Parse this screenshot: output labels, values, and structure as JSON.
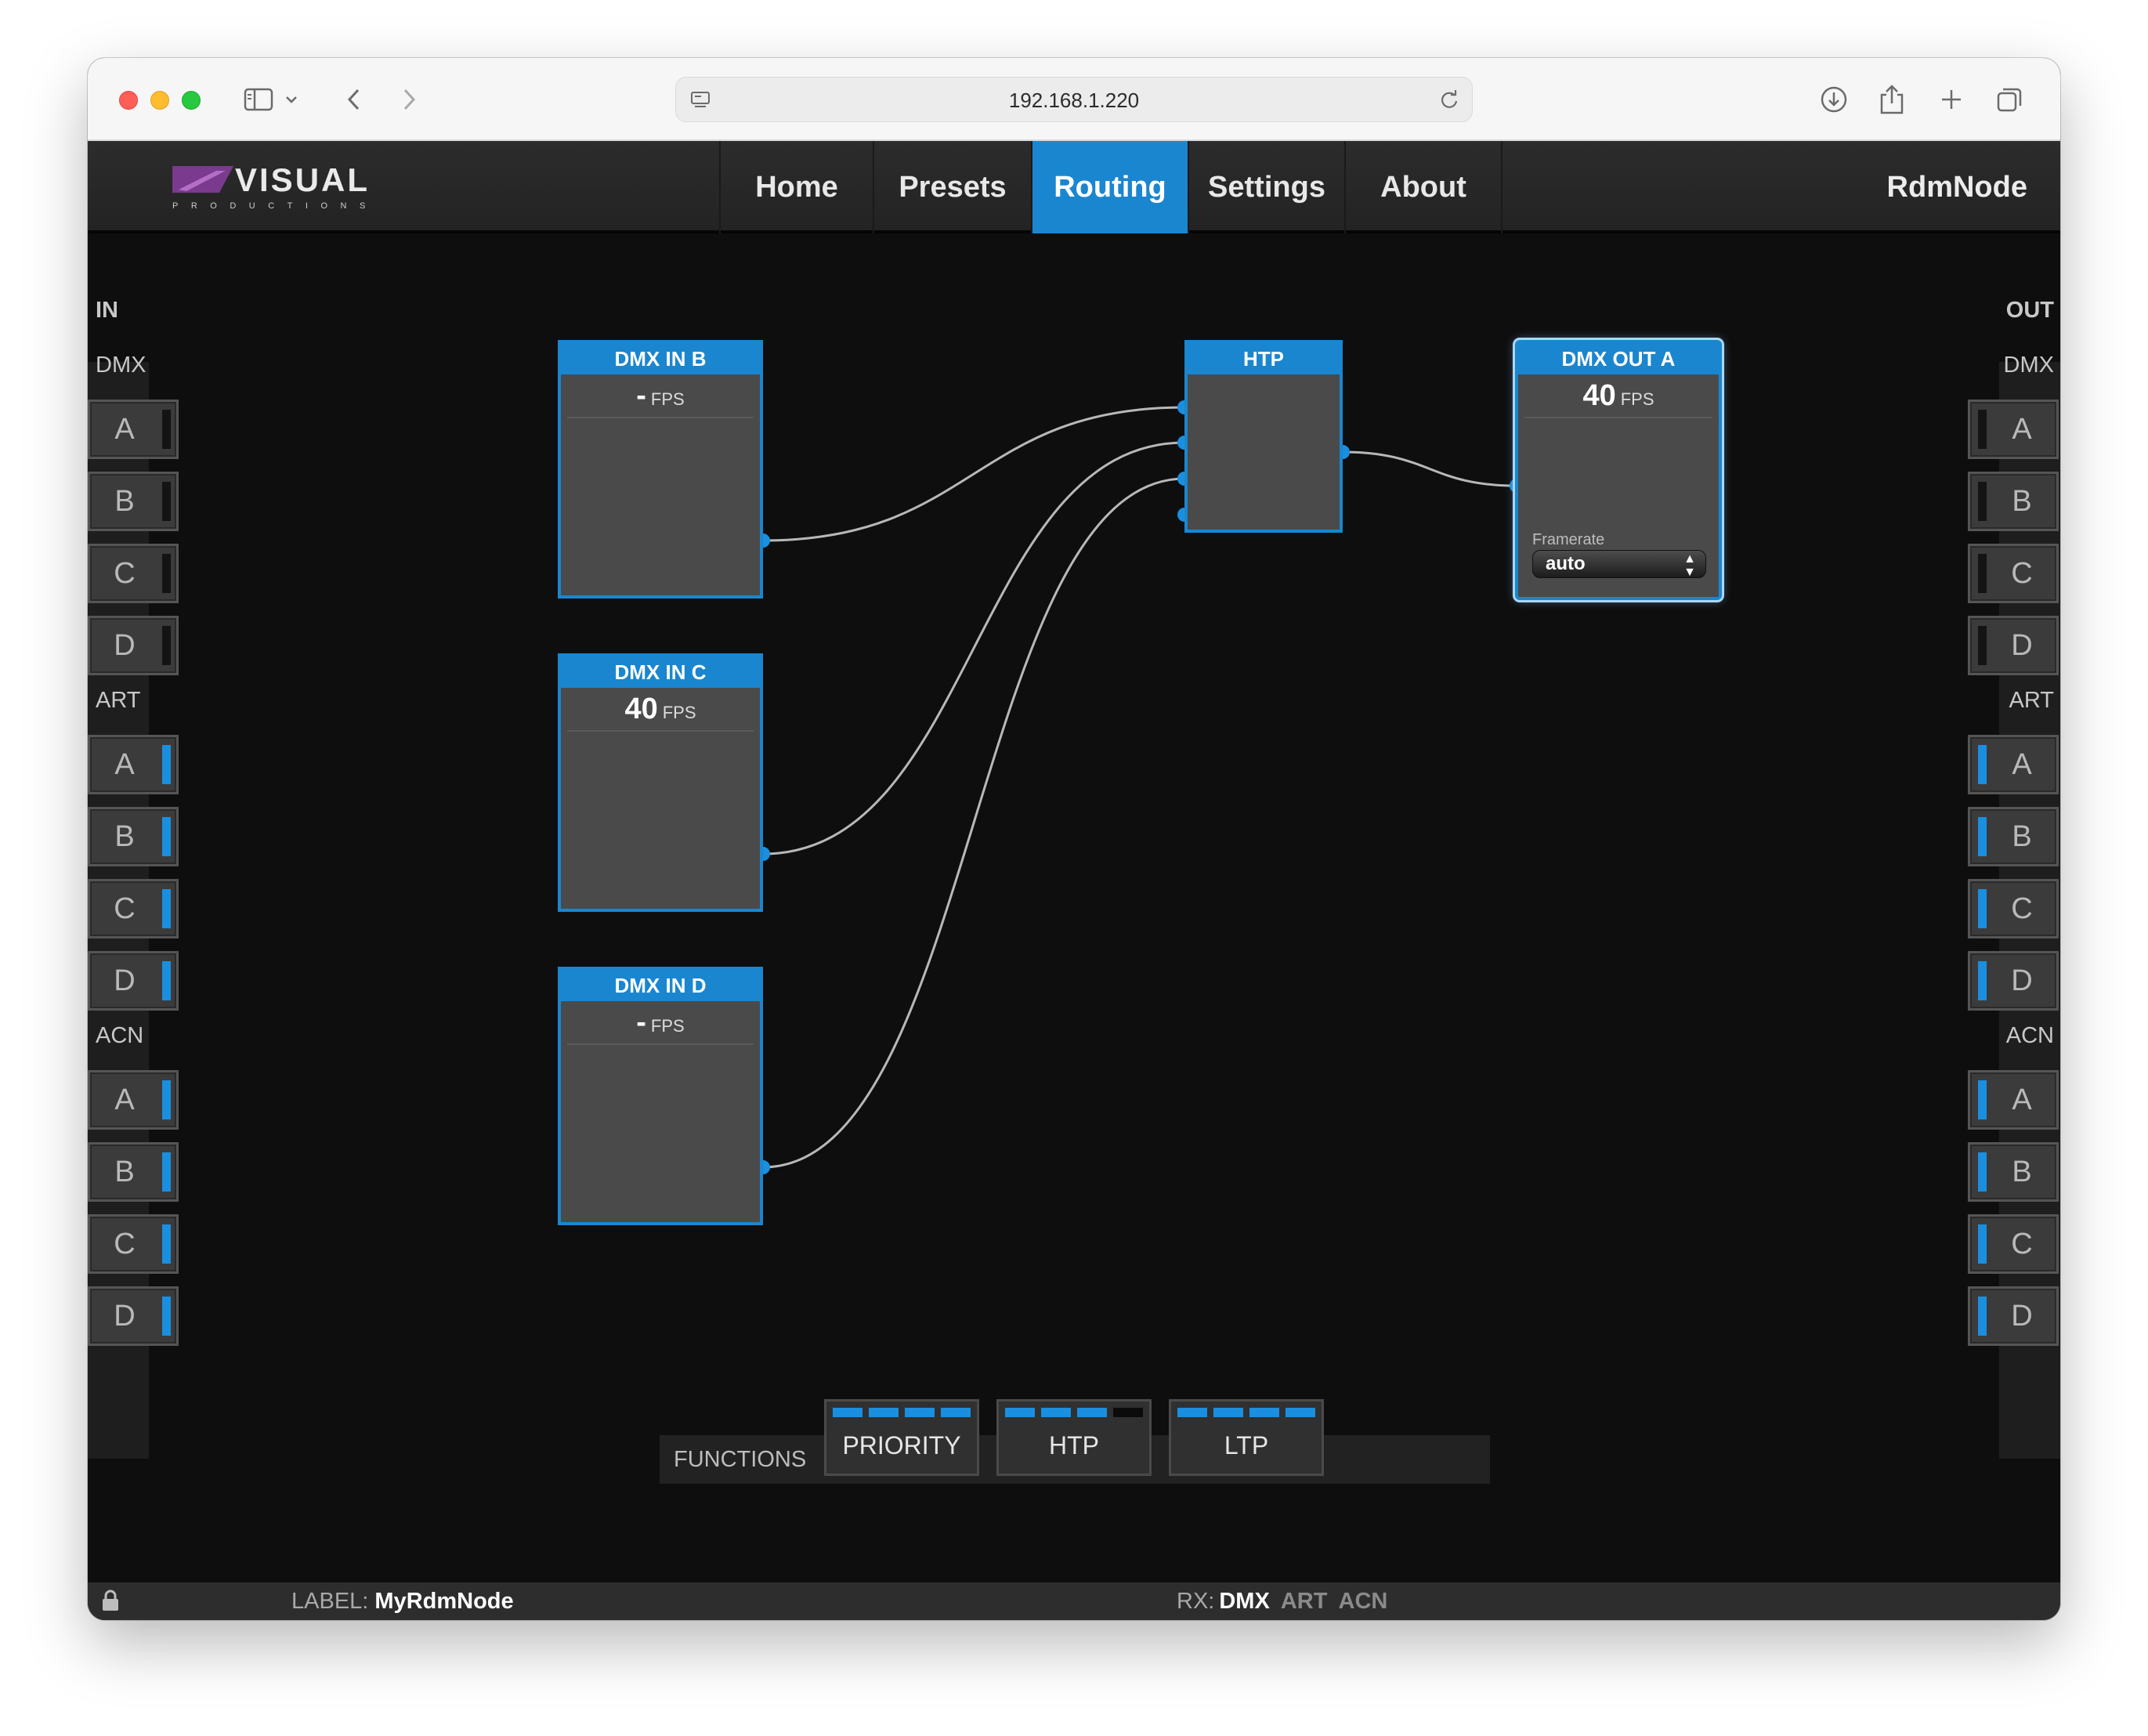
{
  "browser": {
    "url": "192.168.1.220"
  },
  "header": {
    "logo_text": "VISUAL",
    "logo_subtext": "PRODUCTIONS",
    "nav": [
      {
        "label": "Home",
        "active": false
      },
      {
        "label": "Presets",
        "active": false
      },
      {
        "label": "Routing",
        "active": true
      },
      {
        "label": "Settings",
        "active": false
      },
      {
        "label": "About",
        "active": false
      }
    ],
    "device_name": "RdmNode"
  },
  "inputs": {
    "title": "IN",
    "groups": [
      {
        "name": "DMX",
        "ports": [
          {
            "label": "A",
            "active": false
          },
          {
            "label": "B",
            "active": false
          },
          {
            "label": "C",
            "active": false
          },
          {
            "label": "D",
            "active": false
          }
        ]
      },
      {
        "name": "ART",
        "ports": [
          {
            "label": "A",
            "active": true
          },
          {
            "label": "B",
            "active": true
          },
          {
            "label": "C",
            "active": true
          },
          {
            "label": "D",
            "active": true
          }
        ]
      },
      {
        "name": "ACN",
        "ports": [
          {
            "label": "A",
            "active": true
          },
          {
            "label": "B",
            "active": true
          },
          {
            "label": "C",
            "active": true
          },
          {
            "label": "D",
            "active": true
          }
        ]
      }
    ]
  },
  "outputs": {
    "title": "OUT",
    "groups": [
      {
        "name": "DMX",
        "ports": [
          {
            "label": "A",
            "active": false
          },
          {
            "label": "B",
            "active": false
          },
          {
            "label": "C",
            "active": false
          },
          {
            "label": "D",
            "active": false
          }
        ]
      },
      {
        "name": "ART",
        "ports": [
          {
            "label": "A",
            "active": true
          },
          {
            "label": "B",
            "active": true
          },
          {
            "label": "C",
            "active": true
          },
          {
            "label": "D",
            "active": true
          }
        ]
      },
      {
        "name": "ACN",
        "ports": [
          {
            "label": "A",
            "active": true
          },
          {
            "label": "B",
            "active": true
          },
          {
            "label": "C",
            "active": true
          },
          {
            "label": "D",
            "active": true
          }
        ]
      }
    ]
  },
  "nodes": {
    "dmx_in_b": {
      "title": "DMX IN B",
      "fps": "-",
      "fps_unit": "FPS"
    },
    "dmx_in_c": {
      "title": "DMX IN C",
      "fps": "40",
      "fps_unit": "FPS"
    },
    "dmx_in_d": {
      "title": "DMX IN D",
      "fps": "-",
      "fps_unit": "FPS"
    },
    "htp": {
      "title": "HTP"
    },
    "dmx_out_a": {
      "title": "DMX OUT A",
      "fps": "40",
      "fps_unit": "FPS",
      "framerate_label": "Framerate",
      "framerate_value": "auto"
    }
  },
  "functions": {
    "label": "FUNCTIONS",
    "buttons": [
      {
        "label": "PRIORITY",
        "meter": [
          true,
          true,
          true,
          true
        ]
      },
      {
        "label": "HTP",
        "meter": [
          true,
          true,
          true,
          false
        ]
      },
      {
        "label": "LTP",
        "meter": [
          true,
          true,
          true,
          true
        ]
      }
    ]
  },
  "status": {
    "label_prefix": "LABEL:",
    "label_value": "MyRdmNode",
    "rx_prefix": "RX:",
    "rx": [
      {
        "label": "DMX",
        "active": true
      },
      {
        "label": "ART",
        "active": false
      },
      {
        "label": "ACN",
        "active": false
      }
    ]
  },
  "colors": {
    "accent": "#1a86cf",
    "port_active": "#1a8fdf",
    "canvas_bg": "#0e0e0f",
    "node_bg": "#4a4a4b"
  }
}
